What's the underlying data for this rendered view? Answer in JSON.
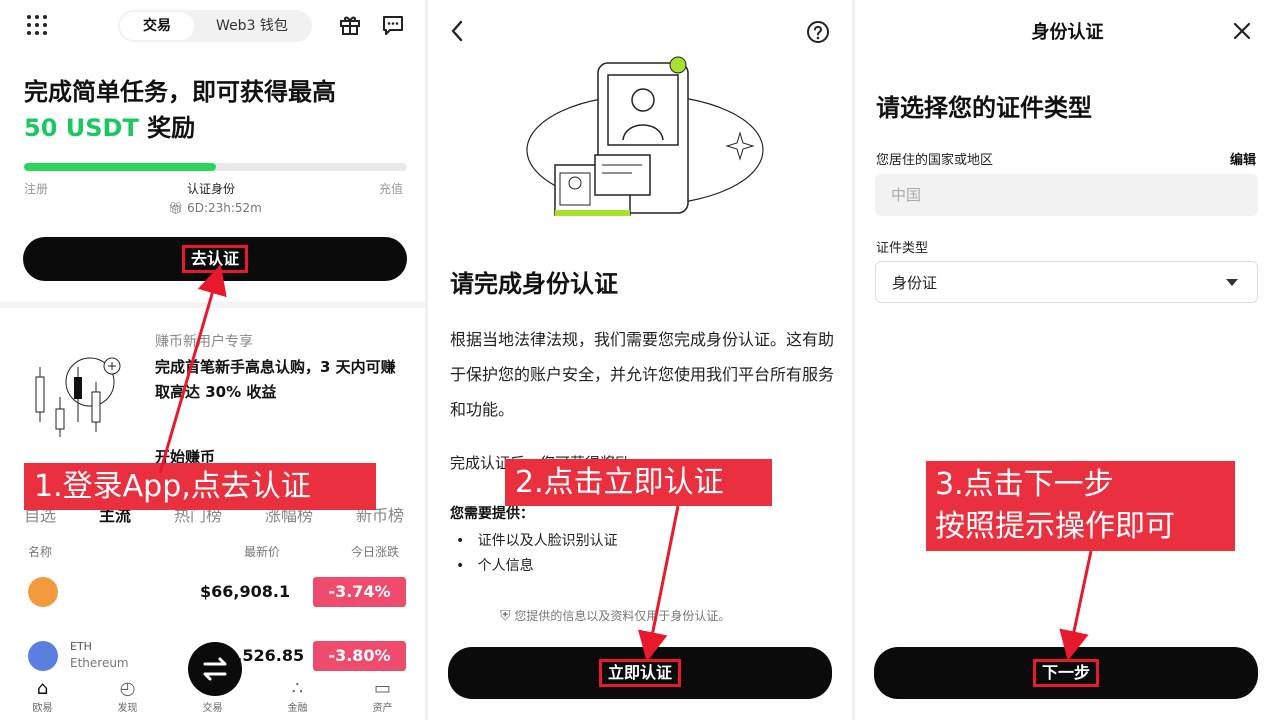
{
  "panel1": {
    "seg_tabs": [
      "交易",
      "Web3 钱包"
    ],
    "headline_line1": "完成简单任务，即可获得最高",
    "headline_amount": "50 USDT",
    "headline_suffix": " 奖励",
    "progress_fraction": 0.5,
    "steps": [
      "注册",
      "认证身份",
      "充值"
    ],
    "timer": "6D:23h:52m",
    "cta": "去认证",
    "promo_title": "赚币新用户专享",
    "promo_desc": "完成首笔新手高息认购，3 天内可赚取高达 30% 收益",
    "promo_link": "开始赚币",
    "callout": "1.登录App,点去认证",
    "market_tabs": [
      "自选",
      "主流",
      "热门榜",
      "涨幅榜",
      "新币榜"
    ],
    "col_name": "名称",
    "col_price": "最新价",
    "col_change": "今日涨跌",
    "rows": [
      {
        "name": "",
        "sub": "",
        "price": "$66,908.1",
        "change": "-3.74%",
        "color": "#f29a3c"
      },
      {
        "name": "ETH",
        "sub": "Ethereum",
        "price": "$3,526.85",
        "change": "-3.80%",
        "color": "#5b7fe0"
      }
    ],
    "nav": [
      "欧易",
      "发现",
      "交易",
      "金融",
      "资产"
    ]
  },
  "panel2": {
    "title": "请完成身份认证",
    "body": "根据当地法律法规，我们需要您完成身份认证。这有助于保护您的账户安全，并允许您使用我们平台所有服务和功能。",
    "done": "完成认证后，您可获得奖励",
    "need": "您需要提供：",
    "bullets": [
      "证件以及人脸识别认证",
      "个人信息"
    ],
    "privacy": "您提供的信息以及资料仅用于身份认证。",
    "cta": "立即认证",
    "callout": "2.点击立即认证"
  },
  "panel3": {
    "title": "身份认证",
    "heading": "请选择您的证件类型",
    "country_label": "您居住的国家或地区",
    "edit": "编辑",
    "country_value": "中国",
    "type_label": "证件类型",
    "type_value": "身份证",
    "cta": "下一步",
    "callout_line1": "3.点击下一步",
    "callout_line2": "按照提示操作即可"
  },
  "colors": {
    "accent_green": "#19c860",
    "annotation_red": "#e8192c",
    "drop_red": "#ef4b6e"
  }
}
